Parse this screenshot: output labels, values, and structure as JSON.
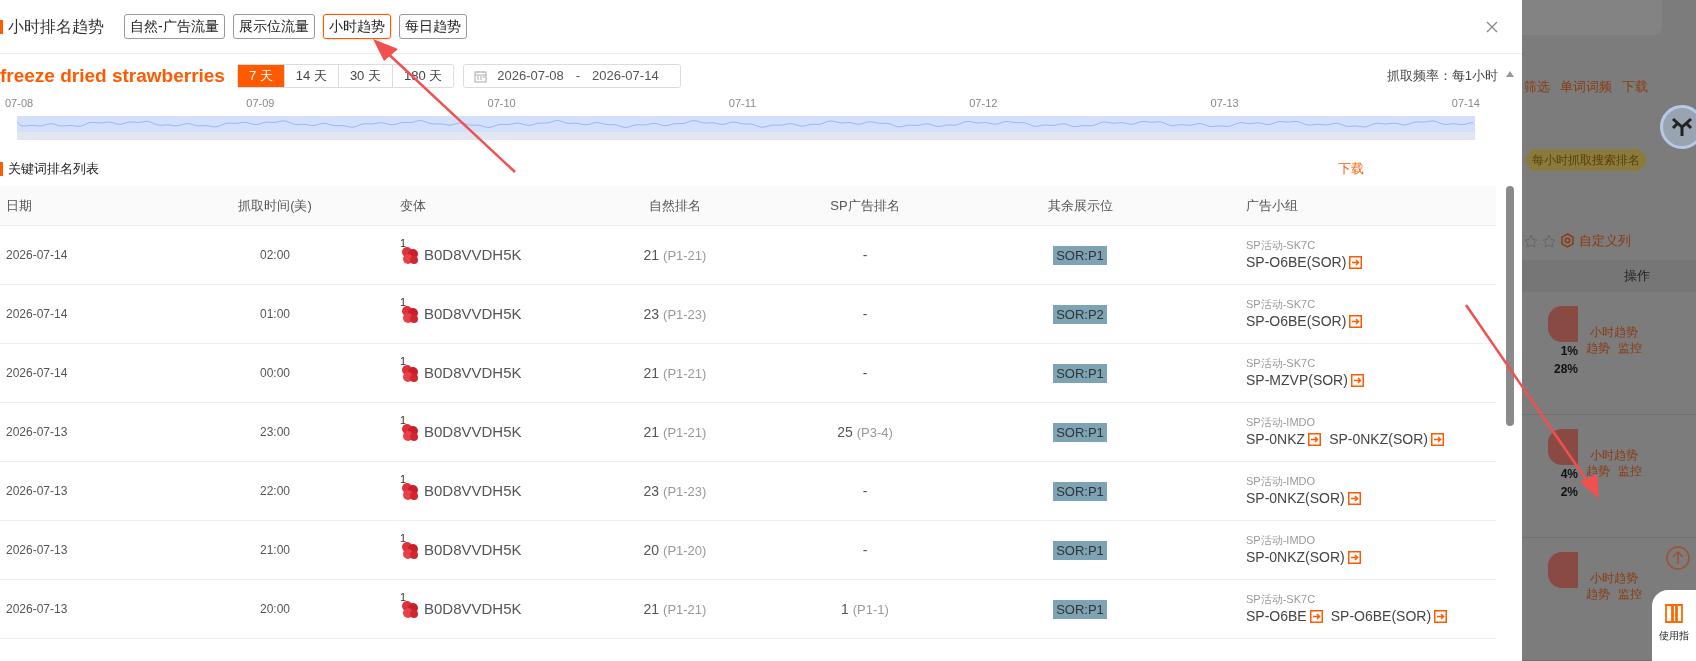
{
  "dialog": {
    "title": "小时排名趋势",
    "tabs": [
      {
        "label": "自然-广告流量",
        "selected": false
      },
      {
        "label": "展示位流量",
        "selected": false
      },
      {
        "label": "小时趋势",
        "selected": true
      },
      {
        "label": "每日趋势",
        "selected": false
      }
    ],
    "keyword": "freeze dried strawberries",
    "range_buttons": [
      {
        "label": "7 天",
        "selected": true
      },
      {
        "label": "14 天",
        "selected": false
      },
      {
        "label": "30 天",
        "selected": false
      },
      {
        "label": "180 天",
        "selected": false
      }
    ],
    "date_range": {
      "start": "2026-07-08",
      "separator": "-",
      "end": "2026-07-14"
    },
    "frequency": "抓取频率：每1小时",
    "timeline": {
      "ticks": [
        "07-08",
        "07-09",
        "07-10",
        "07-11",
        "07-12",
        "07-13",
        "07-14"
      ]
    },
    "list": {
      "title": "关键词排名列表",
      "download": "下载",
      "columns": [
        "日期",
        "抓取时间(美)",
        "变体",
        "自然排名",
        "SP广告排名",
        "其余展示位",
        "广告小组"
      ],
      "rows": [
        {
          "date": "2026-07-14",
          "time": "02:00",
          "variant_count": "1",
          "asin": "B0D8VVDH5K",
          "natural_rank": "21",
          "natural_range": "(P1-21)",
          "sp_rank": "-",
          "placement": "SOR:P1",
          "campaign": "SP活动-SK7C",
          "ad_groups": [
            "SP-O6BE(SOR)"
          ]
        },
        {
          "date": "2026-07-14",
          "time": "01:00",
          "variant_count": "1",
          "asin": "B0D8VVDH5K",
          "natural_rank": "23",
          "natural_range": "(P1-23)",
          "sp_rank": "-",
          "placement": "SOR:P2",
          "campaign": "SP活动-SK7C",
          "ad_groups": [
            "SP-O6BE(SOR)"
          ]
        },
        {
          "date": "2026-07-14",
          "time": "00:00",
          "variant_count": "1",
          "asin": "B0D8VVDH5K",
          "natural_rank": "21",
          "natural_range": "(P1-21)",
          "sp_rank": "-",
          "placement": "SOR:P1",
          "campaign": "SP活动-SK7C",
          "ad_groups": [
            "SP-MZVP(SOR)"
          ]
        },
        {
          "date": "2026-07-13",
          "time": "23:00",
          "variant_count": "1",
          "asin": "B0D8VVDH5K",
          "natural_rank": "21",
          "natural_range": "(P1-21)",
          "sp_rank": "25",
          "sp_range": "(P3-4)",
          "placement": "SOR:P1",
          "campaign": "SP活动-IMDO",
          "ad_groups": [
            "SP-0NKZ",
            "SP-0NKZ(SOR)"
          ]
        },
        {
          "date": "2026-07-13",
          "time": "22:00",
          "variant_count": "1",
          "asin": "B0D8VVDH5K",
          "natural_rank": "23",
          "natural_range": "(P1-23)",
          "sp_rank": "-",
          "placement": "SOR:P1",
          "campaign": "SP活动-IMDO",
          "ad_groups": [
            "SP-0NKZ(SOR)"
          ]
        },
        {
          "date": "2026-07-13",
          "time": "21:00",
          "variant_count": "1",
          "asin": "B0D8VVDH5K",
          "natural_rank": "20",
          "natural_range": "(P1-20)",
          "sp_rank": "-",
          "placement": "SOR:P1",
          "campaign": "SP活动-IMDO",
          "ad_groups": [
            "SP-0NKZ(SOR)"
          ]
        },
        {
          "date": "2026-07-13",
          "time": "20:00",
          "variant_count": "1",
          "asin": "B0D8VVDH5K",
          "natural_rank": "21",
          "natural_range": "(P1-21)",
          "sp_rank": "1",
          "sp_range": "(P1-1)",
          "placement": "SOR:P1",
          "campaign": "SP活动-SK7C",
          "ad_groups": [
            "SP-O6BE",
            "SP-O6BE(SOR)"
          ]
        }
      ]
    }
  },
  "background_page": {
    "links": [
      "筛选",
      "单词词频",
      "下载"
    ],
    "badge": "每小时抓取搜索排名",
    "custom_columns": "自定义列",
    "action_header": "操作",
    "rows": [
      {
        "links": [
          "小时趋势",
          "趋势",
          "监控"
        ],
        "percentages": [
          "1%",
          "28%"
        ]
      },
      {
        "links": [
          "小时趋势",
          "趋势",
          "监控"
        ],
        "percentages": [
          "4%",
          "2%"
        ]
      },
      {
        "links": [
          "小时趋势",
          "趋势",
          "监控"
        ]
      }
    ],
    "guide": "使用指"
  }
}
